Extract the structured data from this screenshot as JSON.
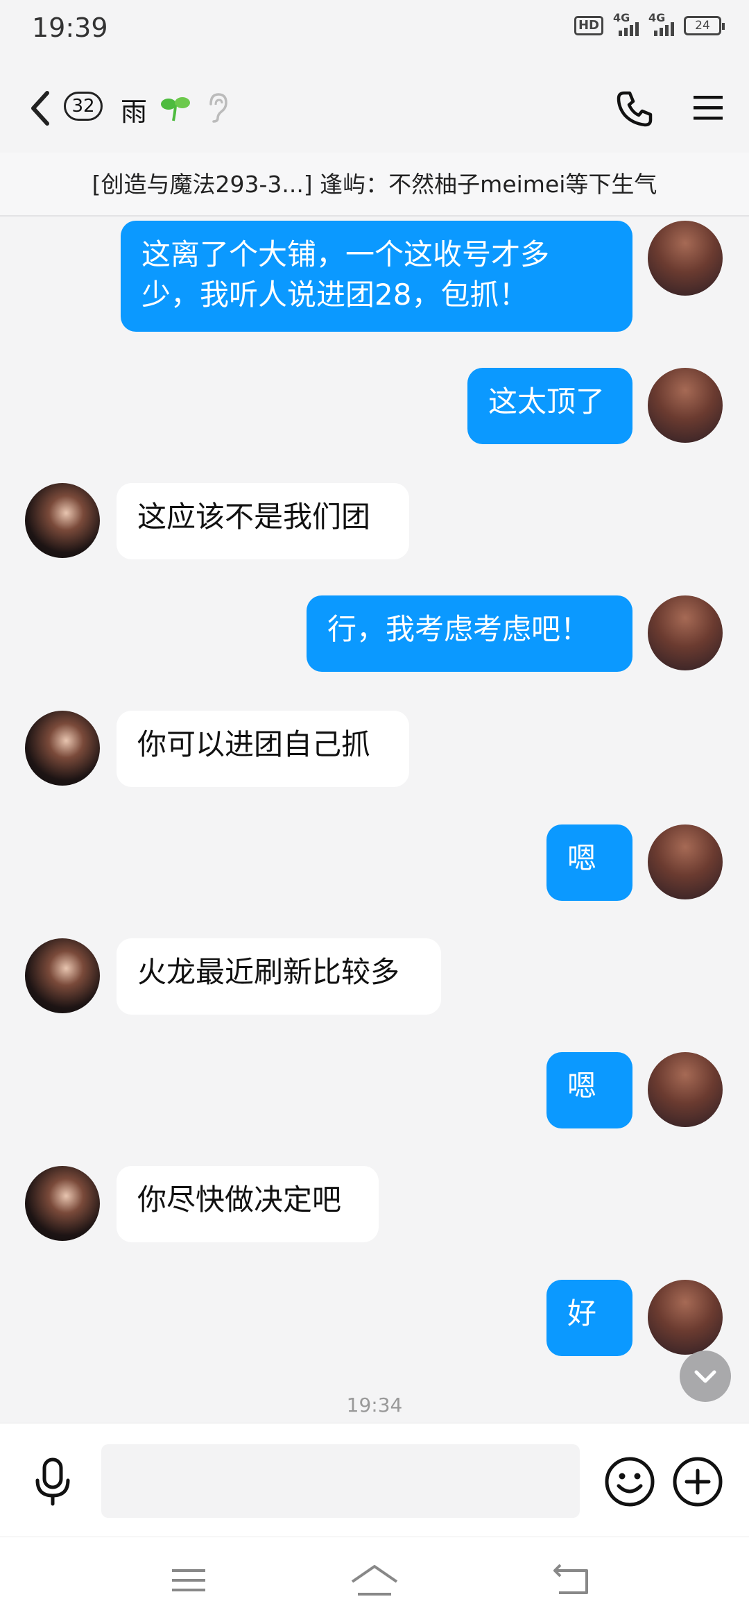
{
  "status_bar": {
    "time": "19:39",
    "hd_label": "HD",
    "net1": "4G",
    "net2": "4G",
    "battery": "24"
  },
  "header": {
    "unread_count": "32",
    "title": "雨",
    "icons": [
      "back-arrow-icon",
      "sprout-icon",
      "ear-icon",
      "phone-icon",
      "menu-icon"
    ]
  },
  "notice": {
    "text": "[创造与魔法293-3...] 逢屿：不然柚子meimei等下生气"
  },
  "messages": [
    {
      "sender": "me",
      "text_lines": [
        "这离了个大铺，一个这收号才多",
        "少，我听人说进团28，包抓！"
      ]
    },
    {
      "sender": "me",
      "text_lines": [
        "这太顶了"
      ]
    },
    {
      "sender": "other",
      "text_lines": [
        "这应该不是我们团"
      ]
    },
    {
      "sender": "me",
      "text_lines": [
        "行，我考虑考虑吧！"
      ]
    },
    {
      "sender": "other",
      "text_lines": [
        "你可以进团自己抓"
      ]
    },
    {
      "sender": "me",
      "text_lines": [
        "嗯"
      ]
    },
    {
      "sender": "other",
      "text_lines": [
        "火龙最近刷新比较多"
      ]
    },
    {
      "sender": "me",
      "text_lines": [
        "嗯"
      ]
    },
    {
      "sender": "other",
      "text_lines": [
        "你尽快做决定吧"
      ]
    },
    {
      "sender": "me",
      "text_lines": [
        "好"
      ]
    }
  ],
  "timestamp": "19:34",
  "input": {
    "placeholder": "",
    "icons": [
      "microphone-icon",
      "emoji-icon",
      "plus-icon"
    ]
  },
  "nav_bar": {
    "icons": [
      "recent-apps-icon",
      "home-icon",
      "back-icon"
    ]
  },
  "colors": {
    "my_bubble": "#0b99ff",
    "other_bubble": "#ffffff",
    "background": "#f4f4f5"
  }
}
